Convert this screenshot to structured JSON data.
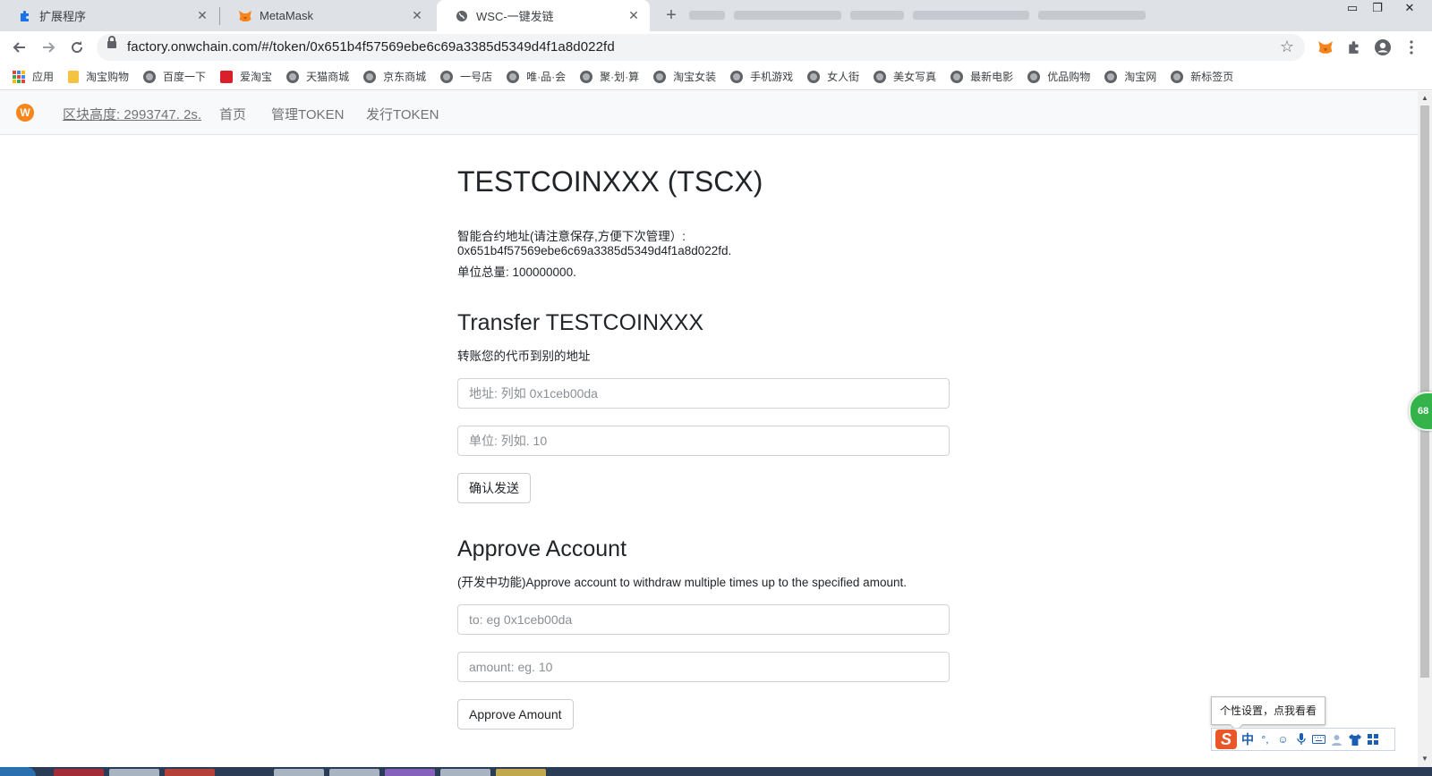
{
  "browser": {
    "tabs": [
      {
        "label": "扩展程序",
        "icon": "puzzle-icon",
        "active": false
      },
      {
        "label": "MetaMask",
        "icon": "fox-icon",
        "active": false
      },
      {
        "label": "WSC-一键发链",
        "icon": "globe-icon",
        "active": true
      }
    ],
    "new_tab": "+",
    "url": "factory.onwchain.com/#/token/0x651b4f57569ebe6c69a3385d5349d4f1a8d022fd",
    "bookmarks": [
      {
        "label": "应用",
        "icon": "apps-grid-icon"
      },
      {
        "label": "淘宝购物",
        "icon": "folder-icon"
      },
      {
        "label": "百度一下",
        "icon": "globe-icon"
      },
      {
        "label": "爱淘宝",
        "icon": "aitaobao-icon"
      },
      {
        "label": "天猫商城",
        "icon": "globe-icon"
      },
      {
        "label": "京东商城",
        "icon": "globe-icon"
      },
      {
        "label": "一号店",
        "icon": "globe-icon"
      },
      {
        "label": "唯·品·会",
        "icon": "globe-icon"
      },
      {
        "label": "聚·划·算",
        "icon": "globe-icon"
      },
      {
        "label": "淘宝女装",
        "icon": "globe-icon"
      },
      {
        "label": "手机游戏",
        "icon": "globe-icon"
      },
      {
        "label": "女人街",
        "icon": "globe-icon"
      },
      {
        "label": "美女写真",
        "icon": "globe-icon"
      },
      {
        "label": "最新电影",
        "icon": "globe-icon"
      },
      {
        "label": "优品购物",
        "icon": "globe-icon"
      },
      {
        "label": "淘宝网",
        "icon": "globe-icon"
      },
      {
        "label": "新标签页",
        "icon": "globe-icon"
      }
    ]
  },
  "navbar": {
    "block_height": "区块高度: 2993747. 2s.",
    "home": "首页",
    "manage": "管理TOKEN",
    "issue": "发行TOKEN"
  },
  "token": {
    "title": "TESTCOINXXX (TSCX)",
    "contract_label": "智能合约地址(请注意保存,方便下次管理）:",
    "contract_address": "0x651b4f57569ebe6c69a3385d5349d4f1a8d022fd.",
    "total_supply": "单位总量: 100000000."
  },
  "transfer": {
    "heading": "Transfer TESTCOINXXX",
    "subtitle": "转账您的代币到别的地址",
    "address_placeholder": "地址: 列如 0x1ceb00da",
    "amount_placeholder": "单位: 列如. 10",
    "submit_label": "确认发送"
  },
  "approve": {
    "heading": "Approve Account",
    "subtitle": "(开发中功能)Approve account to withdraw multiple times up to the specified amount.",
    "to_placeholder": "to: eg 0x1ceb00da",
    "amount_placeholder": "amount: eg. 10",
    "submit_label": "Approve Amount"
  },
  "overlays": {
    "badge_value": "68",
    "ime_tooltip": "个性设置，点我看看",
    "ime_mode": "中",
    "ime_logo": "S"
  },
  "colors": {
    "metamask_orange": "#f6851b",
    "ime_red": "#e8562a",
    "badge_green": "#34b34a"
  }
}
